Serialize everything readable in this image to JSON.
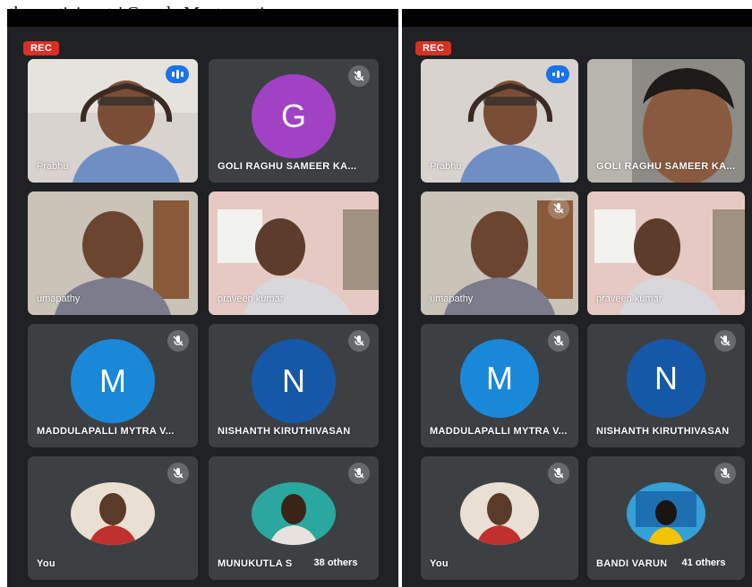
{
  "caption": "the participants' Google Meet meeting",
  "left": {
    "rec": "REC",
    "tiles": [
      {
        "name": "Prabhu"
      },
      {
        "name": "GOLI RAGHU SAMEER KA...",
        "initial": "G"
      },
      {
        "name": "umapathy"
      },
      {
        "name": "praveen kumar"
      },
      {
        "name": "MADDULAPALLI MYTRA V...",
        "initial": "M"
      },
      {
        "name": "NISHANTH KIRUTHIVASAN",
        "initial": "N"
      },
      {
        "name": "You"
      },
      {
        "name": "MUNUKUTLA S"
      }
    ],
    "others": "38 others"
  },
  "right": {
    "rec": "REC",
    "tiles": [
      {
        "name": "Prabhu"
      },
      {
        "name": "GOLI RAGHU SAMEER KA..."
      },
      {
        "name": "umapathy"
      },
      {
        "name": "praveen kumar"
      },
      {
        "name": "MADDULAPALLI MYTRA V...",
        "initial": "M"
      },
      {
        "name": "NISHANTH KIRUTHIVASAN",
        "initial": "N"
      },
      {
        "name": "You"
      },
      {
        "name": "BANDI VARUN"
      }
    ],
    "others": "41 others"
  },
  "colors": {
    "rec": "#d93025",
    "speaking": "#1a73e8",
    "avatar_g": "#a142c4",
    "avatar_m": "#1a88d9",
    "avatar_n": "#1558a8",
    "tile": "#3c4043",
    "background": "#202124"
  },
  "icons": {
    "mic_off": "mic-off-icon",
    "speaking": "audio-level-icon"
  }
}
